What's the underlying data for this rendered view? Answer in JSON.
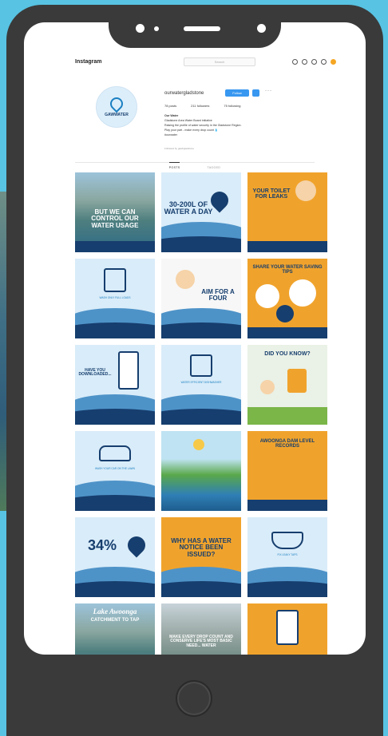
{
  "app": {
    "name": "Instagram",
    "search_placeholder": "Search"
  },
  "profile": {
    "avatar_text": "GAWWATER",
    "username": "ourwatergladstone",
    "follow_label": "Follow",
    "stats": {
      "posts": "78 posts",
      "followers": "211 followers",
      "following": "75 following"
    },
    "bio": {
      "name": "Our Water",
      "lines": [
        "Gladstone Area Water Board initiative",
        "Raising the profile of water security in the Gladstone Region.",
        "Play your part - make every drop count 💧",
        "#ourwater"
      ],
      "followed_by": "Followed by gawbgladstone"
    },
    "tabs": [
      "POSTS",
      "TAGGED"
    ]
  },
  "posts": [
    {
      "title": "BUT WE CAN CONTROL OUR WATER USAGE"
    },
    {
      "title": "30-200L OF WATER A DAY"
    },
    {
      "title": "YOUR TOILET FOR LEAKS"
    },
    {
      "title": "WASH ONLY FULL LOADS"
    },
    {
      "title": "AIM FOR A FOUR"
    },
    {
      "title": "SHARE YOUR WATER SAVING TIPS"
    },
    {
      "title": "HAVE YOU DOWNLOADED..."
    },
    {
      "title": "WATER EFFICIENT DISHWASHER"
    },
    {
      "title": "DID YOU KNOW?"
    },
    {
      "title": "WASH YOUR CAR ON THE LAWN"
    },
    {
      "title": ""
    },
    {
      "title": "AWOONGA DAM LEVEL RECORDS"
    },
    {
      "title": "34%"
    },
    {
      "title": "WHY HAS A WATER NOTICE BEEN ISSUED?"
    },
    {
      "title": "FIX LEAKY TAPS"
    },
    {
      "title": "Lake Awoonga",
      "subtitle": "CATCHMENT TO TAP"
    },
    {
      "title": "MAKE EVERY DROP COUNT AND CONSERVE LIFE'S MOST BASIC NEED... WATER"
    },
    {
      "title": ""
    }
  ],
  "colors": {
    "navy": "#163e6e",
    "light_blue": "#d9ecf9",
    "orange": "#f0a32c",
    "phone": "#3a3a3a",
    "background": "#58c3e3"
  }
}
